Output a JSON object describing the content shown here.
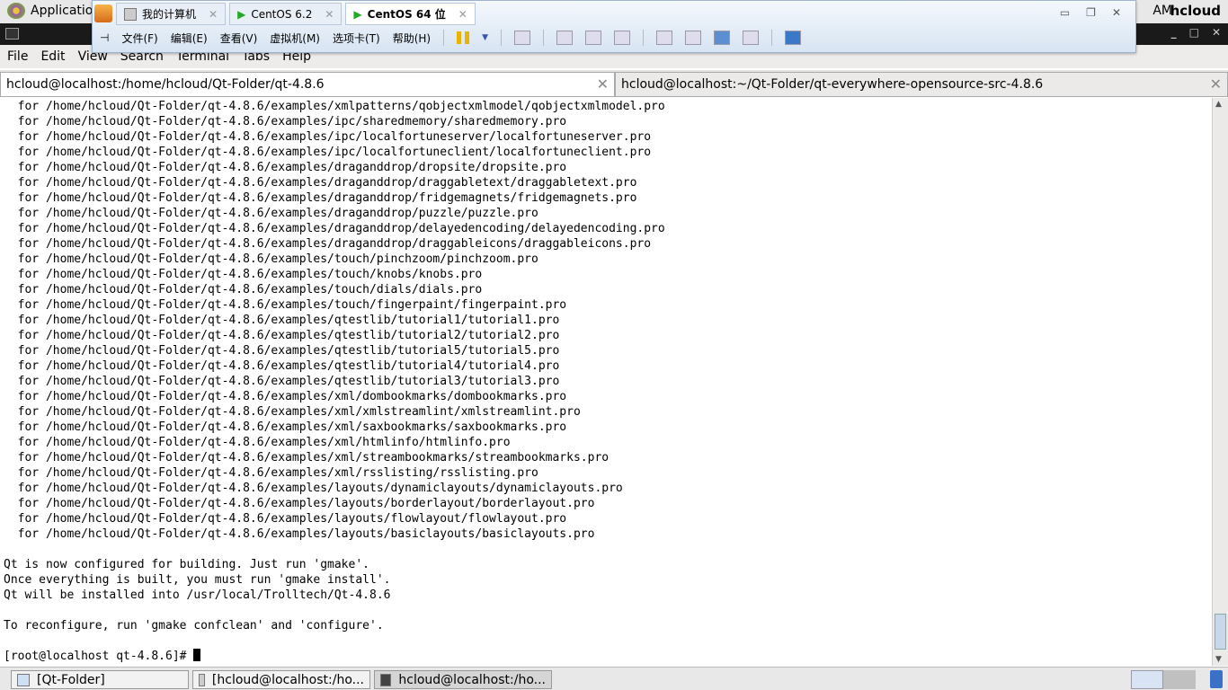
{
  "top_panel": {
    "applications": "Applicatio",
    "clock": "AM",
    "user": "hcloud"
  },
  "vmware": {
    "tabs": [
      {
        "label": "我的计算机"
      },
      {
        "label": "CentOS 6.2"
      },
      {
        "label": "CentOS 64 位"
      }
    ],
    "menu": [
      "文件(F)",
      "编辑(E)",
      "查看(V)",
      "虚拟机(M)",
      "选项卡(T)",
      "帮助(H)"
    ]
  },
  "menubar": [
    "File",
    "Edit",
    "View",
    "Search",
    "Terminal",
    "Tabs",
    "Help"
  ],
  "terminal_tabs": [
    {
      "title": "hcloud@localhost:/home/hcloud/Qt-Folder/qt-4.8.6"
    },
    {
      "title": "hcloud@localhost:~/Qt-Folder/qt-everywhere-opensource-src-4.8.6"
    }
  ],
  "terminal": {
    "lines": [
      "  for /home/hcloud/Qt-Folder/qt-4.8.6/examples/xmlpatterns/qobjectxmlmodel/qobjectxmlmodel.pro",
      "  for /home/hcloud/Qt-Folder/qt-4.8.6/examples/ipc/sharedmemory/sharedmemory.pro",
      "  for /home/hcloud/Qt-Folder/qt-4.8.6/examples/ipc/localfortuneserver/localfortuneserver.pro",
      "  for /home/hcloud/Qt-Folder/qt-4.8.6/examples/ipc/localfortuneclient/localfortuneclient.pro",
      "  for /home/hcloud/Qt-Folder/qt-4.8.6/examples/draganddrop/dropsite/dropsite.pro",
      "  for /home/hcloud/Qt-Folder/qt-4.8.6/examples/draganddrop/draggabletext/draggabletext.pro",
      "  for /home/hcloud/Qt-Folder/qt-4.8.6/examples/draganddrop/fridgemagnets/fridgemagnets.pro",
      "  for /home/hcloud/Qt-Folder/qt-4.8.6/examples/draganddrop/puzzle/puzzle.pro",
      "  for /home/hcloud/Qt-Folder/qt-4.8.6/examples/draganddrop/delayedencoding/delayedencoding.pro",
      "  for /home/hcloud/Qt-Folder/qt-4.8.6/examples/draganddrop/draggableicons/draggableicons.pro",
      "  for /home/hcloud/Qt-Folder/qt-4.8.6/examples/touch/pinchzoom/pinchzoom.pro",
      "  for /home/hcloud/Qt-Folder/qt-4.8.6/examples/touch/knobs/knobs.pro",
      "  for /home/hcloud/Qt-Folder/qt-4.8.6/examples/touch/dials/dials.pro",
      "  for /home/hcloud/Qt-Folder/qt-4.8.6/examples/touch/fingerpaint/fingerpaint.pro",
      "  for /home/hcloud/Qt-Folder/qt-4.8.6/examples/qtestlib/tutorial1/tutorial1.pro",
      "  for /home/hcloud/Qt-Folder/qt-4.8.6/examples/qtestlib/tutorial2/tutorial2.pro",
      "  for /home/hcloud/Qt-Folder/qt-4.8.6/examples/qtestlib/tutorial5/tutorial5.pro",
      "  for /home/hcloud/Qt-Folder/qt-4.8.6/examples/qtestlib/tutorial4/tutorial4.pro",
      "  for /home/hcloud/Qt-Folder/qt-4.8.6/examples/qtestlib/tutorial3/tutorial3.pro",
      "  for /home/hcloud/Qt-Folder/qt-4.8.6/examples/xml/dombookmarks/dombookmarks.pro",
      "  for /home/hcloud/Qt-Folder/qt-4.8.6/examples/xml/xmlstreamlint/xmlstreamlint.pro",
      "  for /home/hcloud/Qt-Folder/qt-4.8.6/examples/xml/saxbookmarks/saxbookmarks.pro",
      "  for /home/hcloud/Qt-Folder/qt-4.8.6/examples/xml/htmlinfo/htmlinfo.pro",
      "  for /home/hcloud/Qt-Folder/qt-4.8.6/examples/xml/streambookmarks/streambookmarks.pro",
      "  for /home/hcloud/Qt-Folder/qt-4.8.6/examples/xml/rsslisting/rsslisting.pro",
      "  for /home/hcloud/Qt-Folder/qt-4.8.6/examples/layouts/dynamiclayouts/dynamiclayouts.pro",
      "  for /home/hcloud/Qt-Folder/qt-4.8.6/examples/layouts/borderlayout/borderlayout.pro",
      "  for /home/hcloud/Qt-Folder/qt-4.8.6/examples/layouts/flowlayout/flowlayout.pro",
      "  for /home/hcloud/Qt-Folder/qt-4.8.6/examples/layouts/basiclayouts/basiclayouts.pro",
      "",
      "Qt is now configured for building. Just run 'gmake'.",
      "Once everything is built, you must run 'gmake install'.",
      "Qt will be installed into /usr/local/Trolltech/Qt-4.8.6",
      "",
      "To reconfigure, run 'gmake confclean' and 'configure'.",
      ""
    ],
    "prompt": "[root@localhost qt-4.8.6]# "
  },
  "taskbar": [
    {
      "label": "[Qt-Folder]"
    },
    {
      "label": "[hcloud@localhost:/ho..."
    },
    {
      "label": "hcloud@localhost:/ho..."
    }
  ]
}
